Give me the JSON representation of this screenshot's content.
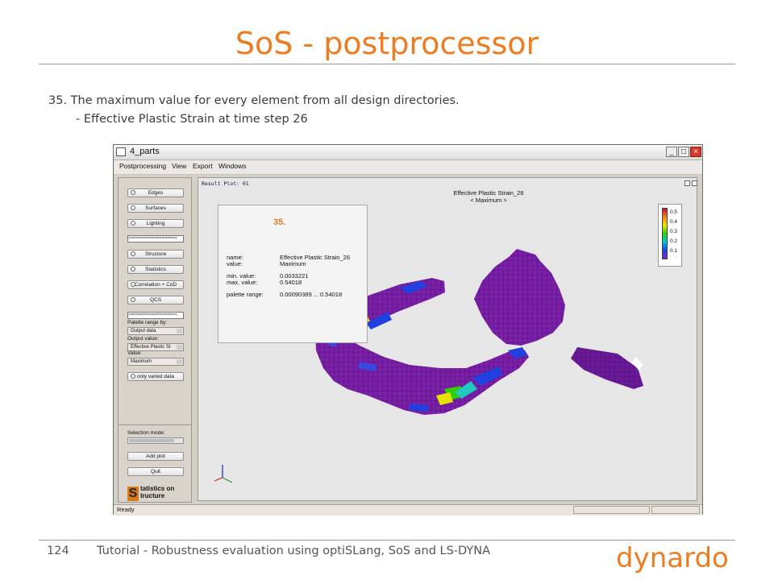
{
  "slide": {
    "title": "SoS - postprocessor",
    "line1": "35. The maximum value for every element from all design directories.",
    "line2": "- Effective Plastic Strain at time step 26",
    "page_number": "124",
    "footer": "Tutorial - Robustness evaluation using optiSLang, SoS and LS-DYNA",
    "logo_text": "dynardo"
  },
  "window": {
    "title": "4_parts",
    "menu": [
      "Postprocessing",
      "View",
      "Export",
      "Windows"
    ],
    "status": "Ready"
  },
  "left_panel": {
    "buttons": {
      "edges": "Edges",
      "surfaces": "Surfaces",
      "lighting": "Lighting",
      "structure": "Structure",
      "statistics": "Statistics",
      "correlation": "Correlation + CoD",
      "qcs": "QCS",
      "only_varied": "only varied data",
      "add_plot": "Add plot",
      "quit": "Quit"
    },
    "separator": ">=================<",
    "palette_label": "Palette range by:",
    "palette_value": "Output data",
    "output_label": "Output value:",
    "output_value": "Effective Plastic St",
    "value_label": "Value:",
    "value_value": "Maximum",
    "selection_label": "Selection mode:",
    "brand_letter": "S",
    "brand_line1": "tatistics on",
    "brand_line2": "tructure"
  },
  "plot": {
    "title": "Result Plot: 01",
    "heading_line1": "Effective Plastic Strain_26",
    "heading_line2": "< Maximum >",
    "info": {
      "number": "35.",
      "name_key": "name:",
      "name_val": "Effective Plastic Strain_26",
      "value_key": "value:",
      "value_val": "Maximum",
      "min_key": "min. value:",
      "min_val": "0.0033221",
      "max_key": "max. value:",
      "max_val": "0.54018",
      "palette_key": "palette range:",
      "palette_val": "0.00090389 ... 0.54018"
    },
    "legend": [
      "0.5",
      "0.4",
      "0.3",
      "0.2",
      "0.1"
    ]
  },
  "colors": {
    "title_accent": "#ee7d22",
    "part_base": "#7a1fa8",
    "part_dark": "#5a1a88"
  }
}
